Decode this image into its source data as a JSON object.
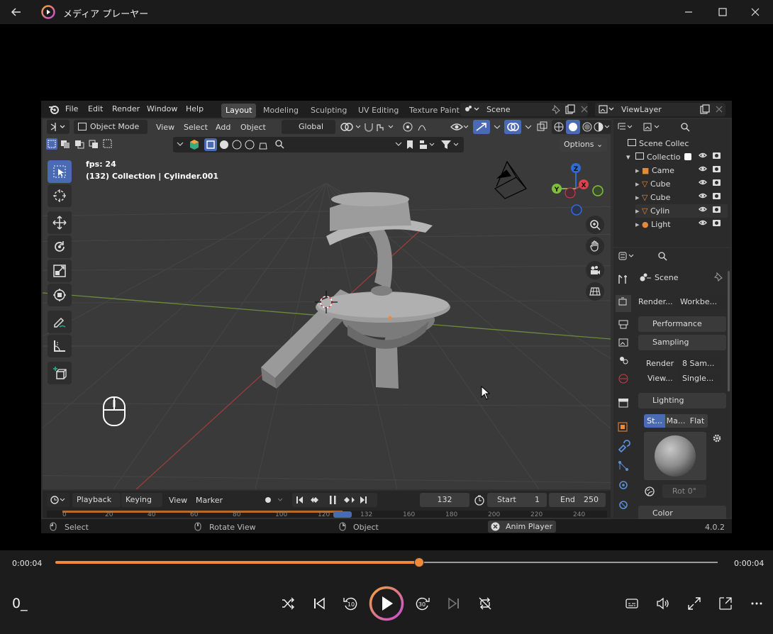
{
  "app": {
    "title": "メディア プレーヤー"
  },
  "blender": {
    "menu": [
      "File",
      "Edit",
      "Render",
      "Window",
      "Help"
    ],
    "workspaces": [
      "Layout",
      "Modeling",
      "Sculpting",
      "UV Editing",
      "Texture Paint"
    ],
    "scene_name": "Scene",
    "view_layer": "ViewLayer",
    "header": {
      "mode": "Object Mode",
      "view": "View",
      "select": "Select",
      "add": "Add",
      "object": "Object",
      "transform": "Global",
      "options": "Options"
    },
    "overlay": {
      "fps": "fps: 24",
      "info": "(132) Collection | Cylinder.001"
    },
    "gizmo": {
      "z": "Z",
      "y": "Y",
      "x": "X"
    },
    "outliner": {
      "root": "Scene Collec",
      "collection": "Collectio",
      "items": [
        "Came",
        "Cube",
        "Cube",
        "Cylin",
        "Light"
      ]
    },
    "properties": {
      "scene": "Scene",
      "render_label": "Render...",
      "render_engine": "Workbe...",
      "performance": "Performance",
      "sampling": "Sampling",
      "render_samples_label": "Render",
      "render_samples": "8 Sam...",
      "viewport_label": "View...",
      "viewport_value": "Single...",
      "lighting": "Lighting",
      "lighting_tabs": [
        "St...",
        "Ma...",
        "Flat"
      ],
      "rotation": "Rot  0°",
      "color": "Color"
    },
    "timeline": {
      "playback": "Playback",
      "keying": "Keying",
      "view": "View",
      "marker": "Marker",
      "frame": "132",
      "start_label": "Start",
      "start": "1",
      "end_label": "End",
      "end": "250",
      "ruler": [
        "0",
        "20",
        "40",
        "60",
        "80",
        "100",
        "120",
        "132",
        "160",
        "180",
        "200",
        "220",
        "240"
      ],
      "playhead_fraction": 0.528
    },
    "statusbar": {
      "select": "Select",
      "rotate": "Rotate View",
      "object": "Object",
      "anim": "Anim Player",
      "version": "4.0.2"
    }
  },
  "player": {
    "time_current": "0:00:04",
    "time_total": "0:00:04",
    "progress": 0.549,
    "left_label": "0_"
  },
  "colors": {
    "accent": "#f08a3a",
    "accent2": "#c54cd8",
    "blender_blue": "#4a6bb3"
  }
}
